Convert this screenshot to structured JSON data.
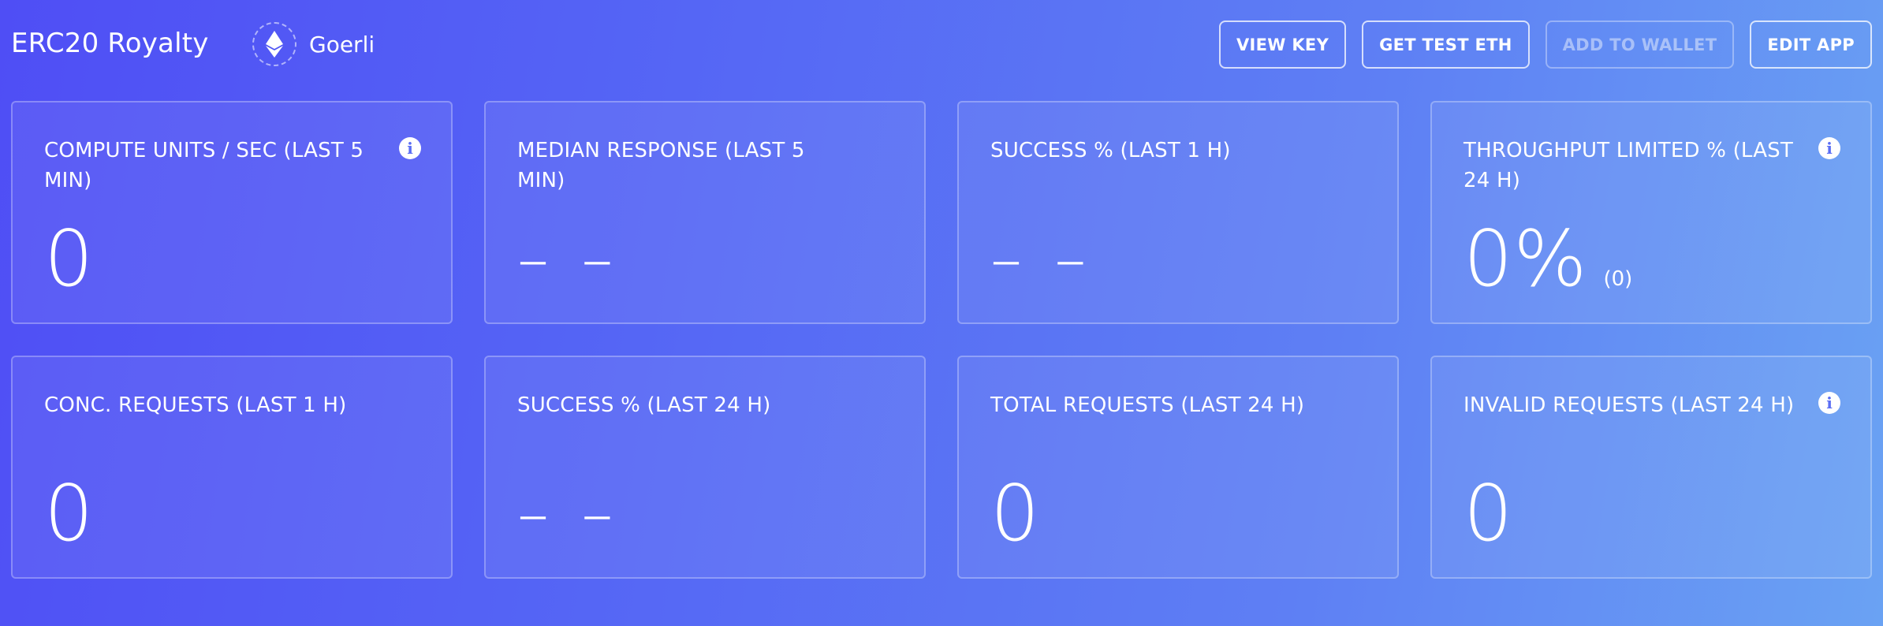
{
  "header": {
    "app_name": "ERC20 Royalty",
    "network": {
      "icon": "ethereum-icon",
      "label": "Goerli"
    }
  },
  "actions": [
    {
      "label": "VIEW KEY",
      "enabled": true
    },
    {
      "label": "GET TEST ETH",
      "enabled": true
    },
    {
      "label": "ADD TO WALLET",
      "enabled": false
    },
    {
      "label": "EDIT APP",
      "enabled": true
    }
  ],
  "stats": [
    {
      "label": "COMPUTE UNITS / SEC (LAST 5 MIN)",
      "value": "0",
      "sub": "",
      "info": true
    },
    {
      "label": "MEDIAN RESPONSE (LAST 5 MIN)",
      "value": "– –",
      "sub": "",
      "info": false
    },
    {
      "label": "SUCCESS % (LAST 1 H)",
      "value": "– –",
      "sub": "",
      "info": false
    },
    {
      "label": "THROUGHPUT LIMITED % (LAST 24 H)",
      "value": "0%",
      "sub": "(0)",
      "info": true
    },
    {
      "label": "CONC. REQUESTS (LAST 1 H)",
      "value": "0",
      "sub": "",
      "info": false
    },
    {
      "label": "SUCCESS % (LAST 24 H)",
      "value": "– –",
      "sub": "",
      "info": false
    },
    {
      "label": "TOTAL REQUESTS (LAST 24 H)",
      "value": "0",
      "sub": "",
      "info": false
    },
    {
      "label": "INVALID REQUESTS (LAST 24 H)",
      "value": "0",
      "sub": "",
      "info": true
    }
  ],
  "colors": {
    "background_start": "#4f4ef5",
    "background_end": "#6aa2f3",
    "text": "#ffffff"
  }
}
